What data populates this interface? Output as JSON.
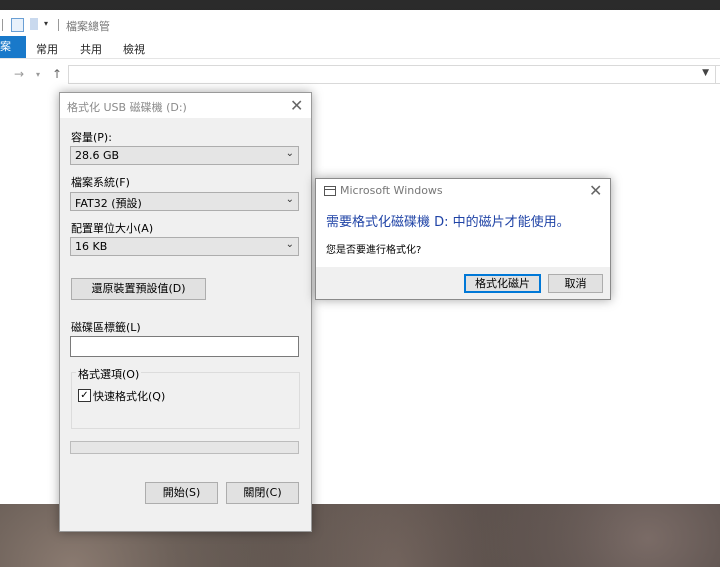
{
  "explorer": {
    "title": "檔案總管",
    "tabs": {
      "file": "案",
      "home": "常用",
      "share": "共用",
      "view": "檢視"
    },
    "address": ""
  },
  "format_dialog": {
    "title": "格式化 USB 磁碟機 (D:)",
    "capacity_label": "容量(P):",
    "capacity_value": "28.6 GB",
    "filesystem_label": "檔案系統(F)",
    "filesystem_value": "FAT32 (預設)",
    "unit_label": "配置單位大小(A)",
    "unit_value": "16 KB",
    "restore_button": "還原裝置預設值(D)",
    "volume_label": "磁碟區標籤(L)",
    "volume_value": "",
    "options_label": "格式選項(O)",
    "quick_format_label": "快速格式化(Q)",
    "quick_format_checked": true,
    "progress_percent": 0,
    "start_button": "開始(S)",
    "close_button": "關閉(C)"
  },
  "message_box": {
    "title": "Microsoft Windows",
    "main_text": "需要格式化磁碟機 D: 中的磁片才能使用。",
    "sub_text": "您是否要進行格式化?",
    "format_button": "格式化磁片",
    "cancel_button": "取消"
  },
  "icons": {
    "close": "close-icon",
    "dropdown": "chevron-down-icon",
    "check": "check-icon"
  }
}
